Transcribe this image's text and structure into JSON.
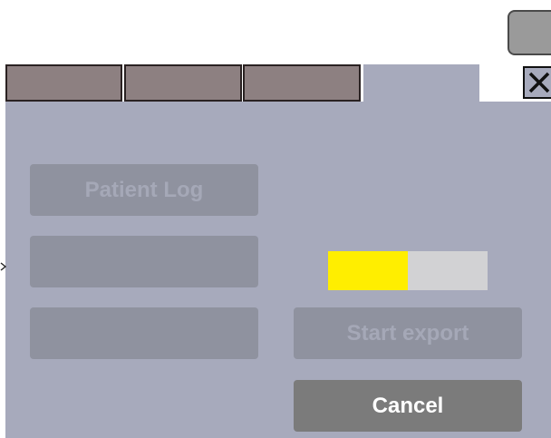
{
  "tabs": [
    {
      "label": "",
      "active": false
    },
    {
      "label": "",
      "active": false
    },
    {
      "label": "",
      "active": false
    },
    {
      "label": "",
      "active": true
    }
  ],
  "header": {
    "top_right_button_label": "",
    "close_icon": "close-icon"
  },
  "main": {
    "patient_log_label": "Patient Log",
    "empty_button_1_label": "",
    "empty_button_2_label": "",
    "start_export_label": "Start export",
    "cancel_label": "Cancel",
    "progress_fraction": 0.5,
    "side_arrow_icon": "chevron-right-icon"
  },
  "colors": {
    "panel": "#a7aabc",
    "inactive_tab": "#8d8081",
    "disabled_button": "#8f929f",
    "cancel_button": "#7b7b7b",
    "progress_fill": "#ffee00",
    "progress_track": "#d2d2d4"
  }
}
